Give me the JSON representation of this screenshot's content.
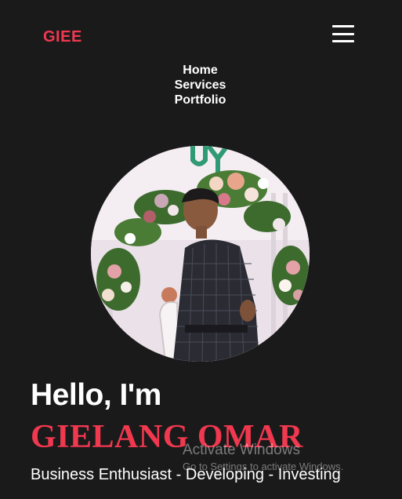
{
  "header": {
    "logo": "GIEE",
    "menu_icon": "hamburger-menu-icon",
    "accent": "#f0384f"
  },
  "nav": {
    "items": [
      "Home",
      "Services",
      "Portfolio"
    ]
  },
  "hero": {
    "greeting": "Hello, I'm",
    "name": "GIELANG OMAR",
    "tagline": "Business Enthusiast - Developing - Investing",
    "photo_description_alt": "Profile photo"
  },
  "watermark": {
    "title": "Activate Windows",
    "subtitle": "Go to Settings to activate Windows."
  },
  "colors": {
    "background": "#1b1a1b",
    "text": "#ffffff",
    "accent": "#f0384f"
  }
}
